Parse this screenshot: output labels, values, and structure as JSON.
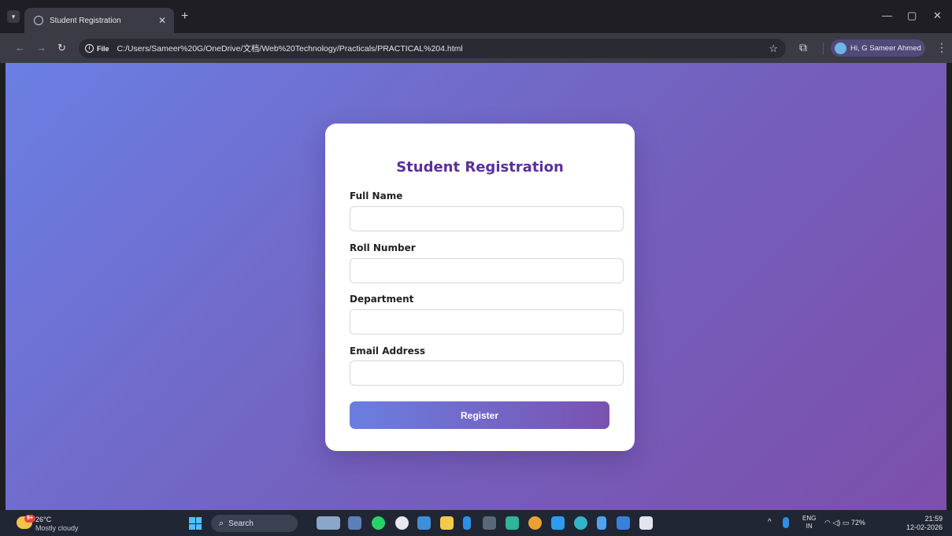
{
  "browser": {
    "tab_title": "Student Registration",
    "file_chip": "File",
    "url": "C:/Users/Sameer%20G/OneDrive/文档/Web%20Technology/Practicals/PRACTICAL%204.html",
    "profile_label": "Hi, G Sameer Ahmed"
  },
  "form": {
    "title": "Student Registration",
    "fields": [
      {
        "label": "Full Name",
        "value": ""
      },
      {
        "label": "Roll Number",
        "value": ""
      },
      {
        "label": "Department",
        "value": ""
      },
      {
        "label": "Email Address",
        "value": ""
      }
    ],
    "submit_label": "Register"
  },
  "taskbar": {
    "weather_badge": "9+",
    "temperature": "26°C",
    "weather": "Mostly cloudy",
    "search_label": "Search",
    "lang_top": "ENG",
    "lang_bottom": "IN",
    "battery": "72%",
    "time": "21:59",
    "date": "12-02-2026"
  },
  "colors": {
    "accent": "#5a2f9c",
    "gradient_start": "#6a7fe4",
    "gradient_end": "#7c4fab"
  }
}
